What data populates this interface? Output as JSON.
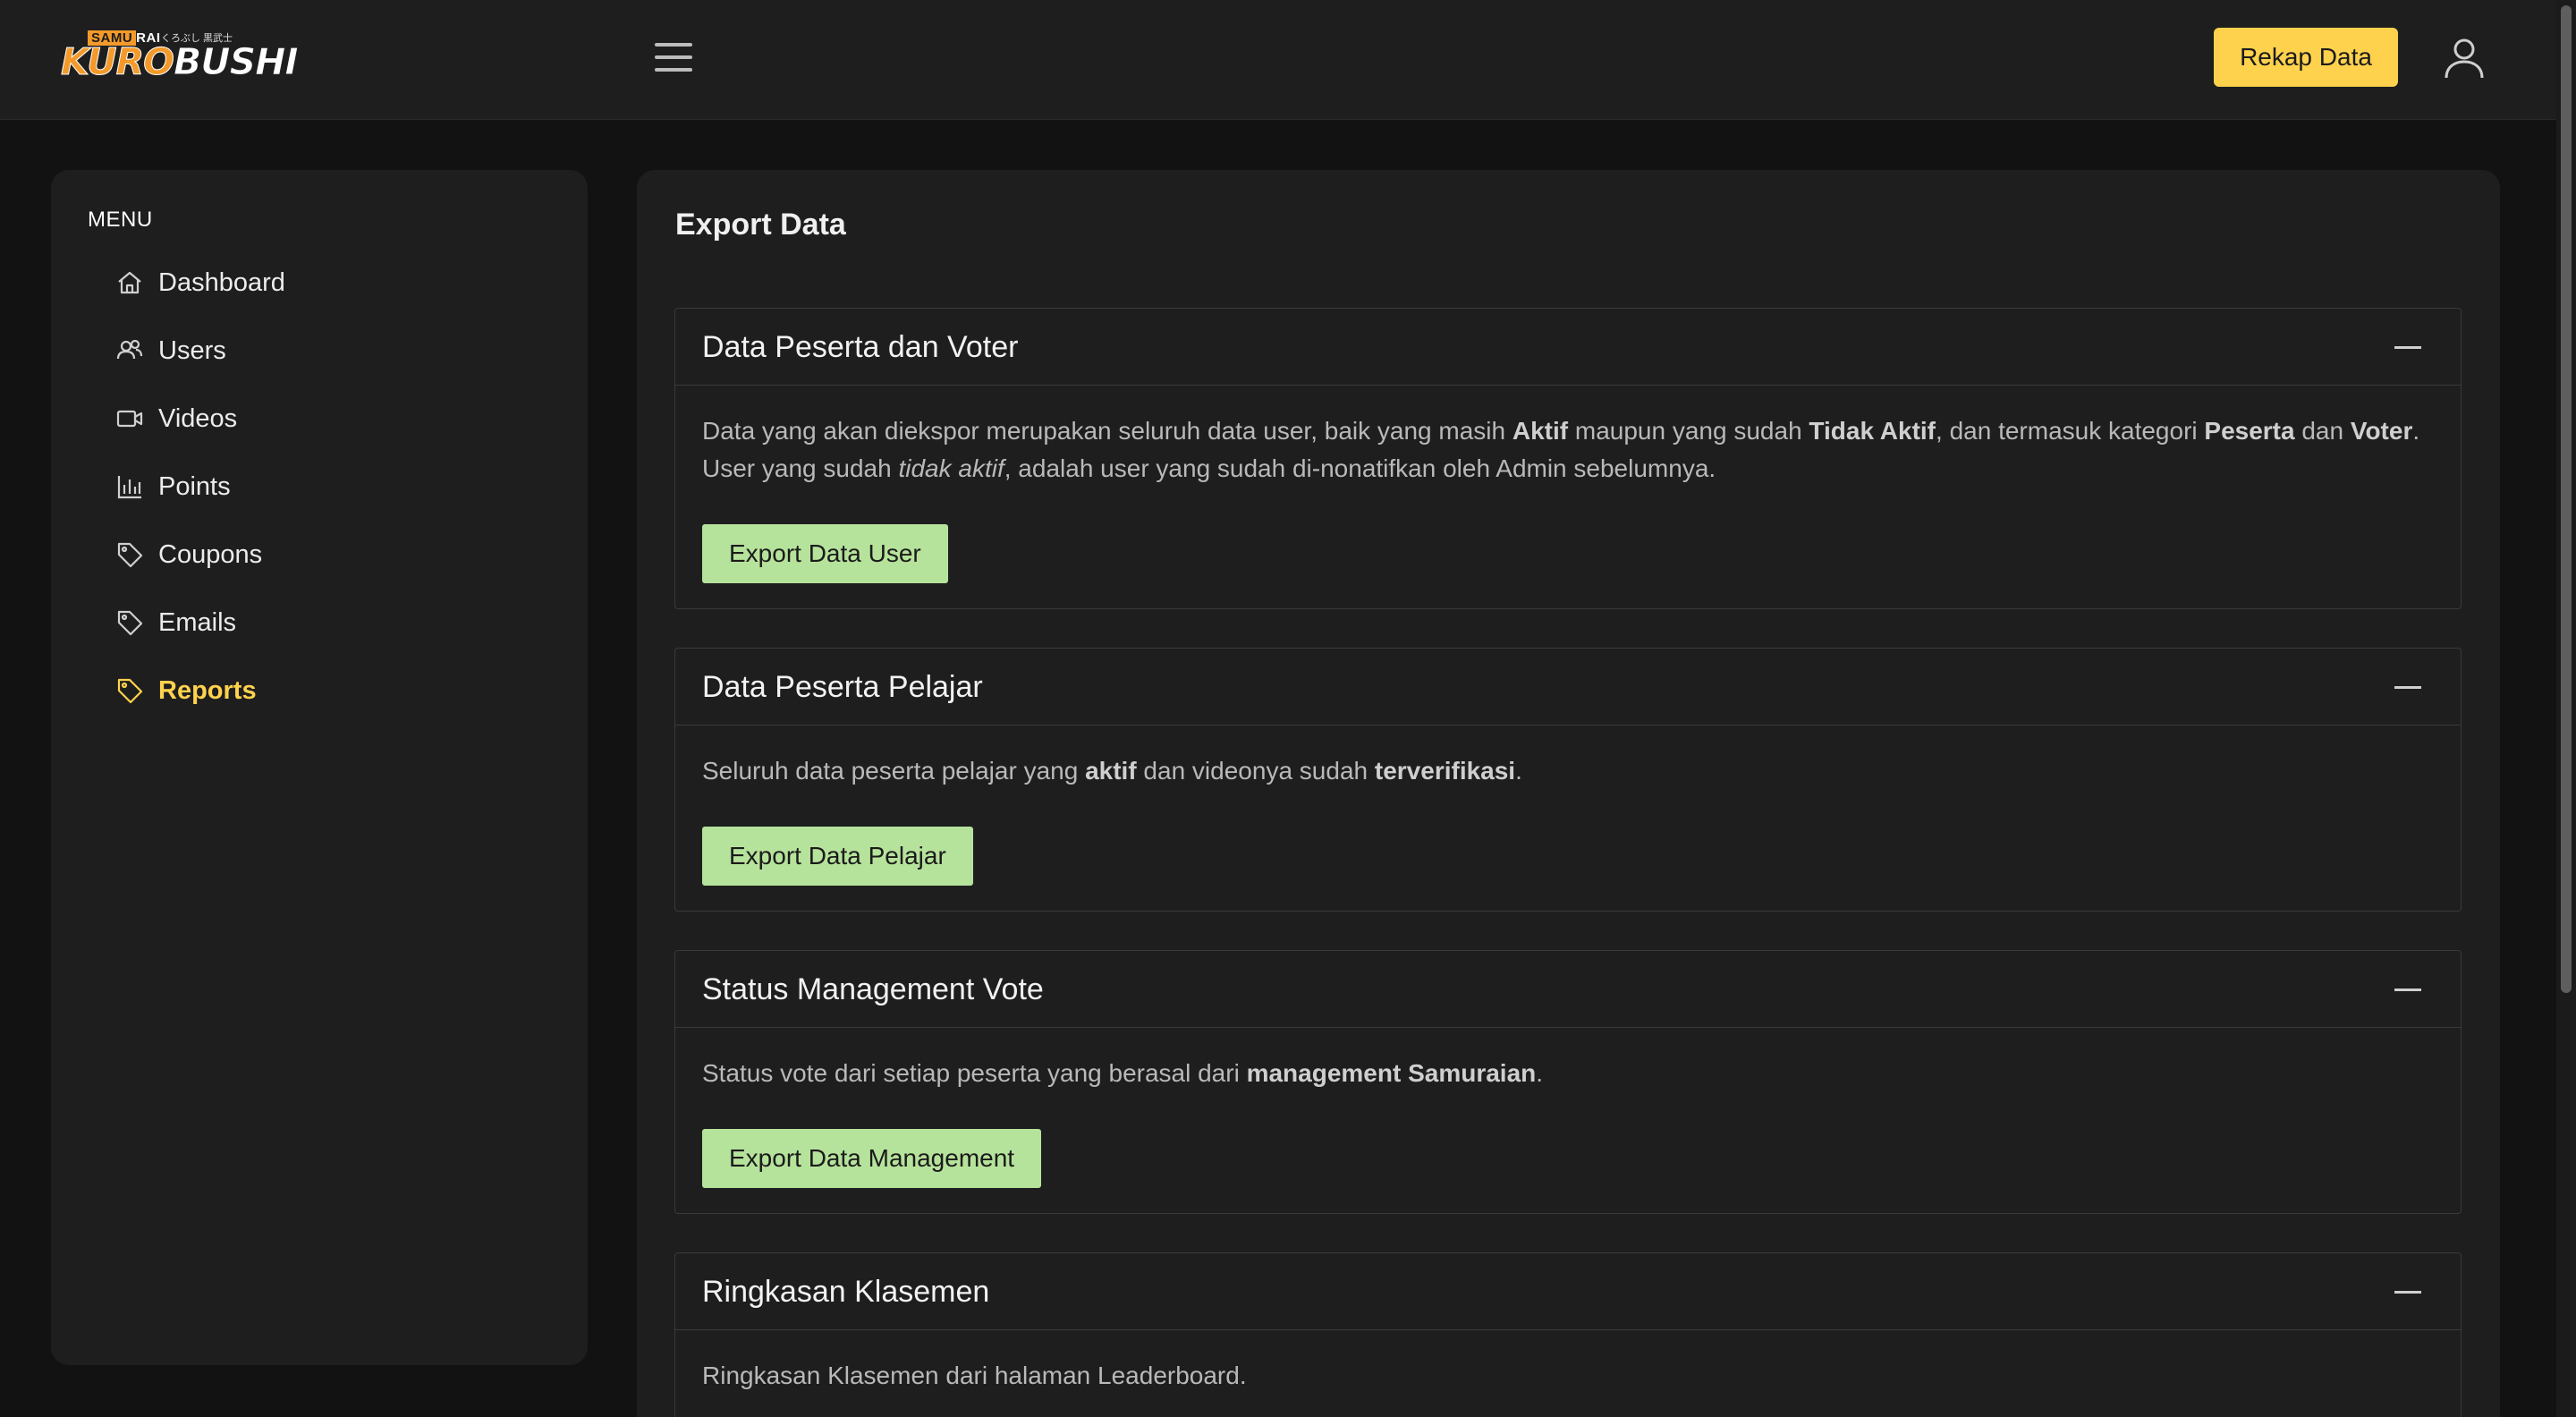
{
  "header": {
    "logo": {
      "top_highlight": "SAMU",
      "top_rest": "RAI",
      "jp": "くろぶし 黒武士",
      "main_orange": "KURO",
      "main_white": "BUSHI"
    },
    "rekap_label": "Rekap Data"
  },
  "sidebar": {
    "title": "MENU",
    "items": [
      {
        "label": "Dashboard",
        "icon": "home-icon"
      },
      {
        "label": "Users",
        "icon": "users-icon"
      },
      {
        "label": "Videos",
        "icon": "video-icon"
      },
      {
        "label": "Points",
        "icon": "bar-chart-icon"
      },
      {
        "label": "Coupons",
        "icon": "tag-icon"
      },
      {
        "label": "Emails",
        "icon": "tag-icon"
      },
      {
        "label": "Reports",
        "icon": "tag-icon",
        "active": true
      }
    ]
  },
  "main": {
    "title": "Export Data",
    "cards": [
      {
        "title": "Data Peserta dan Voter",
        "desc": {
          "t1": "Data yang akan diekspor merupakan seluruh data user, baik yang masih ",
          "b1": "Aktif",
          "t2": " maupun yang sudah ",
          "b2": "Tidak Aktif",
          "t3": ", dan termasuk kategori ",
          "b3": "Peserta",
          "t4": " dan ",
          "b4": "Voter",
          "t5": ". User yang sudah ",
          "i1": "tidak aktif",
          "t6": ", adalah user yang sudah di-nonatifkan oleh Admin sebelumnya."
        },
        "button": "Export Data User"
      },
      {
        "title": "Data Peserta Pelajar",
        "desc": {
          "t1": "Seluruh data peserta pelajar yang ",
          "b1": "aktif",
          "t2": " dan videonya sudah ",
          "b2": "terverifikasi",
          "t3": "."
        },
        "button": "Export Data Pelajar"
      },
      {
        "title": "Status Management Vote",
        "desc": {
          "t1": "Status vote dari setiap peserta yang berasal dari ",
          "b1": "management Samuraian",
          "t2": "."
        },
        "button": "Export Data Management"
      },
      {
        "title": "Ringkasan Klasemen",
        "desc": {
          "t1": "Ringkasan Klasemen dari halaman Leaderboard."
        }
      }
    ]
  },
  "colors": {
    "accent": "#ffd24d",
    "export_button": "#b6e39b",
    "panel": "#1e1e1e",
    "background": "#121212"
  }
}
